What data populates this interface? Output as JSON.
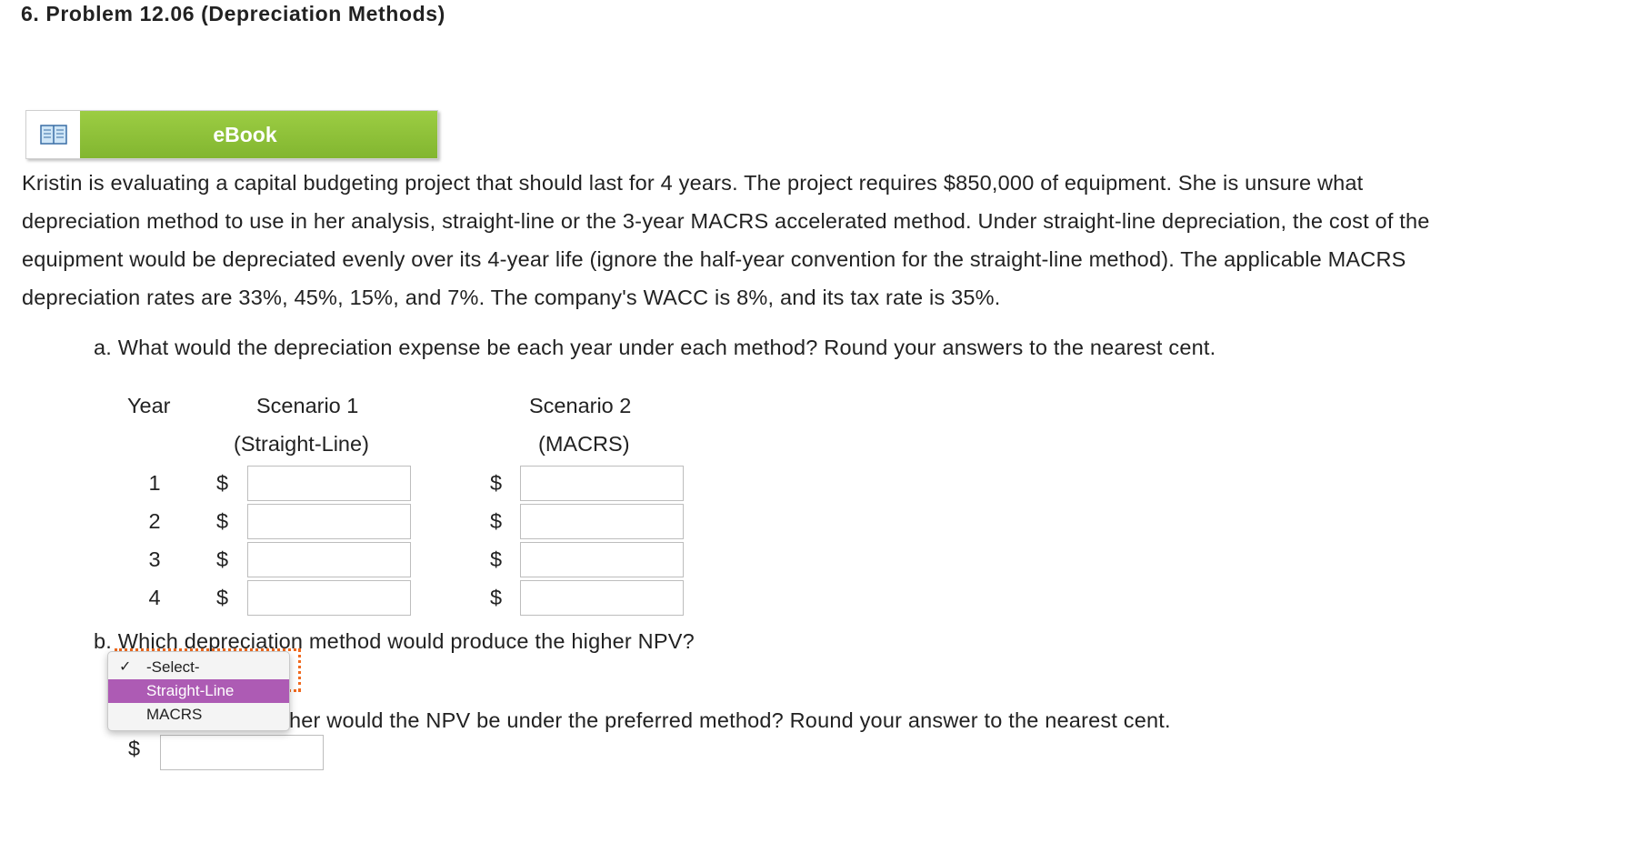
{
  "problem": {
    "title": "6. Problem 12.06 (Depreciation Methods)"
  },
  "ebook": {
    "label": "eBook",
    "icon": "book-icon"
  },
  "paragraph": {
    "lines": [
      "Kristin is evaluating a capital budgeting project that should last for 4 years. The project requires $850,000 of equipment. She is unsure what",
      "depreciation method to use in her analysis, straight-line or the 3-year MACRS accelerated method. Under straight-line depreciation, the cost of the",
      "equipment would be depreciated evenly over its 4-year life (ignore the half-year convention for the straight-line method). The applicable MACRS",
      "depreciation rates are 33%, 45%, 15%, and 7%. The company's WACC is 8%, and its tax rate is 35%."
    ]
  },
  "question_a": {
    "text": "a.  What would the depreciation expense be each year under each method? Round your answers to the nearest cent.",
    "table": {
      "year_header": "Year",
      "scenario1_header": "Scenario 1",
      "scenario1_sub": "(Straight-Line)",
      "scenario2_header": "Scenario 2",
      "scenario2_sub": "(MACRS)",
      "currency": "$",
      "rows": [
        {
          "year": "1",
          "s1": "",
          "s2": ""
        },
        {
          "year": "2",
          "s1": "",
          "s2": ""
        },
        {
          "year": "3",
          "s1": "",
          "s2": ""
        },
        {
          "year": "4",
          "s1": "",
          "s2": ""
        }
      ]
    }
  },
  "question_b": {
    "text": "b.  Which depreciation method would produce the higher NPV?",
    "dropdown": {
      "options": [
        "-Select-",
        "Straight-Line",
        "MACRS"
      ],
      "checked_option": "-Select-",
      "highlighted_option": "Straight-Line"
    }
  },
  "question_c": {
    "visible_text": "her would the NPV be under the preferred method? Round your answer to the nearest cent.",
    "currency": "$",
    "answer": ""
  },
  "colors": {
    "ebook_green": "#8cc13a",
    "dropdown_highlight": "#ad5bb4",
    "focus_outline": "#f06a1f"
  }
}
